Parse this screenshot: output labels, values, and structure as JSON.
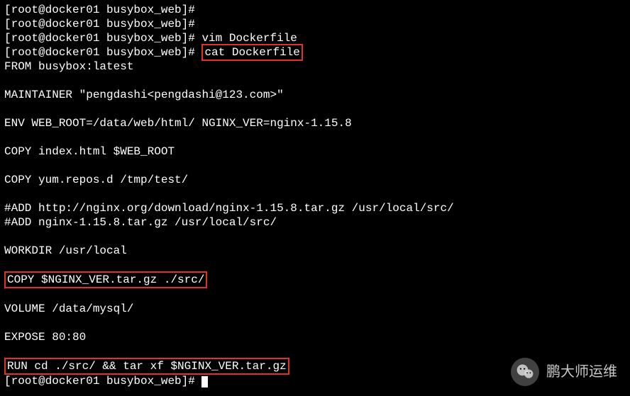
{
  "prompt": "[root@docker01 busybox_web]# ",
  "lines": [
    {
      "prefix": "",
      "cmd": ""
    },
    {
      "prefix": "",
      "cmd": ""
    },
    {
      "prefix": "",
      "cmd": "vim Dockerfile"
    },
    {
      "prefix": "",
      "cmd_boxed": "cat Dockerfile"
    }
  ],
  "file": [
    "FROM busybox:latest",
    "",
    "MAINTAINER \"pengdashi<pengdashi@123.com>\"",
    "",
    "ENV WEB_ROOT=/data/web/html/ NGINX_VER=nginx-1.15.8",
    "",
    "COPY index.html $WEB_ROOT",
    "",
    "COPY yum.repos.d /tmp/test/",
    "",
    "#ADD http://nginx.org/download/nginx-1.15.8.tar.gz /usr/local/src/",
    "#ADD nginx-1.15.8.tar.gz /usr/local/src/",
    "",
    "WORKDIR /usr/local",
    ""
  ],
  "boxed_line1": "COPY $NGINX_VER.tar.gz ./src/",
  "file2": [
    "",
    "VOLUME /data/mysql/",
    "",
    "EXPOSE 80:80",
    ""
  ],
  "boxed_line2": "RUN cd ./src/ && tar xf $NGINX_VER.tar.gz",
  "endprompt": "[root@docker01 busybox_web]# ",
  "watermark": {
    "icon": "❖",
    "text": "鹏大师运维"
  }
}
